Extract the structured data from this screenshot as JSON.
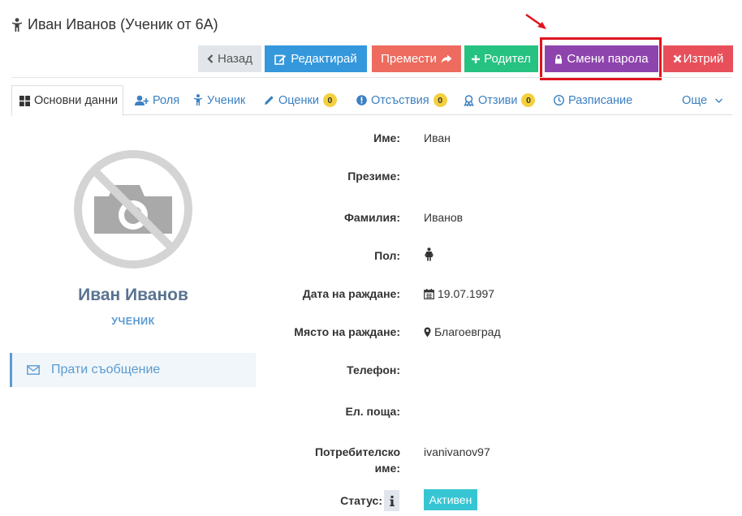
{
  "header": {
    "title": "Иван Иванов (Ученик от 6А)",
    "title_icon": "child-icon"
  },
  "toolbar": {
    "back": "Назад",
    "edit": "Редактирай",
    "move": "Премести",
    "parent": "Родител",
    "change_password": "Смени парола",
    "delete": "Изтрий",
    "colors": {
      "back": "#e2e6ea",
      "edit": "#3598dc",
      "move": "#ed6b5f",
      "parent": "#26c281",
      "change_password": "#8e44ad",
      "delete": "#e7505a"
    }
  },
  "tabs": [
    {
      "label": "Основни данни",
      "icon": "grid-icon",
      "active": true
    },
    {
      "label": "Роля",
      "icon": "user-plus-icon"
    },
    {
      "label": "Ученик",
      "icon": "child-icon"
    },
    {
      "label": "Оценки",
      "icon": "pencil-icon",
      "badge": "0"
    },
    {
      "label": "Отсъствия",
      "icon": "exclamation-circle-icon",
      "badge": "0"
    },
    {
      "label": "Отзиви",
      "icon": "award-icon",
      "badge": "0"
    },
    {
      "label": "Разписание",
      "icon": "clock-icon"
    },
    {
      "label": "Още",
      "icon": "chevron-down-icon"
    }
  ],
  "profile": {
    "name": "Иван Иванов",
    "role": "УЧЕНИК",
    "send_message": "Прати съобщение"
  },
  "fields": {
    "first_name": {
      "label": "Име:",
      "value": "Иван"
    },
    "middle_name": {
      "label": "Презиме:",
      "value": ""
    },
    "last_name": {
      "label": "Фамилия:",
      "value": "Иванов"
    },
    "gender": {
      "label": "Пол:",
      "icon": "female-icon"
    },
    "birth_date": {
      "label": "Дата на раждане:",
      "value": "19.07.1997"
    },
    "birth_place": {
      "label": "Място на раждане:",
      "value": "Благоевград"
    },
    "phone": {
      "label": "Телефон:",
      "value": ""
    },
    "email": {
      "label": "Ел. поща:",
      "value": ""
    },
    "username": {
      "label_line1": "Потребителско",
      "label_line2": "име:",
      "value": "ivanivanov97"
    },
    "status": {
      "label": "Статус:",
      "value": "Активен"
    }
  }
}
